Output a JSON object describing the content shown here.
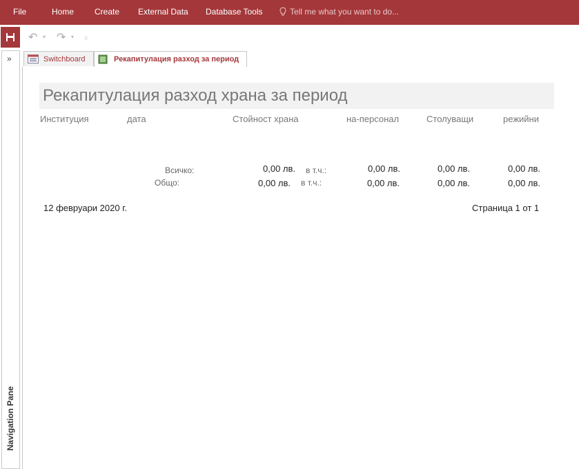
{
  "ribbon": {
    "menus": [
      "File",
      "Home",
      "Create",
      "External Data",
      "Database Tools"
    ],
    "tell_me": "Tell me what you want to do...",
    "color": "#a4373a"
  },
  "quick_access": {
    "icons": [
      "save-icon",
      "undo-icon",
      "redo-icon"
    ]
  },
  "nav_pane": {
    "label": "Navigation Pane",
    "toggle": "»"
  },
  "tabs": [
    {
      "label": "Switchboard",
      "icon": "form-icon",
      "active": false
    },
    {
      "label": "Рекапитулация разход за период",
      "icon": "report-icon",
      "active": true
    }
  ],
  "report": {
    "title": "Рекапитулация разход храна за период",
    "headers": [
      "Институция",
      "дата",
      "Стойност храна",
      "на-персонал",
      "Столуващи",
      "режийни"
    ],
    "row_all": {
      "label": "Всичко:",
      "stoinost": "0,00 лв.",
      "vtch": "в т.ч.:",
      "na_personal": "0,00 лв.",
      "stoluvashti": "0,00 лв.",
      "rejiini": "0,00 лв."
    },
    "row_total": {
      "label": "Общо:",
      "stoinost": "0,00 лв.",
      "vtch": "в т.ч.:",
      "na_personal": "0,00 лв.",
      "stoluvashti": "0,00 лв.",
      "rejiini": "0,00 лв."
    },
    "date": "12 февруари 2020 г.",
    "page_info": "Страница 1 от 1"
  }
}
